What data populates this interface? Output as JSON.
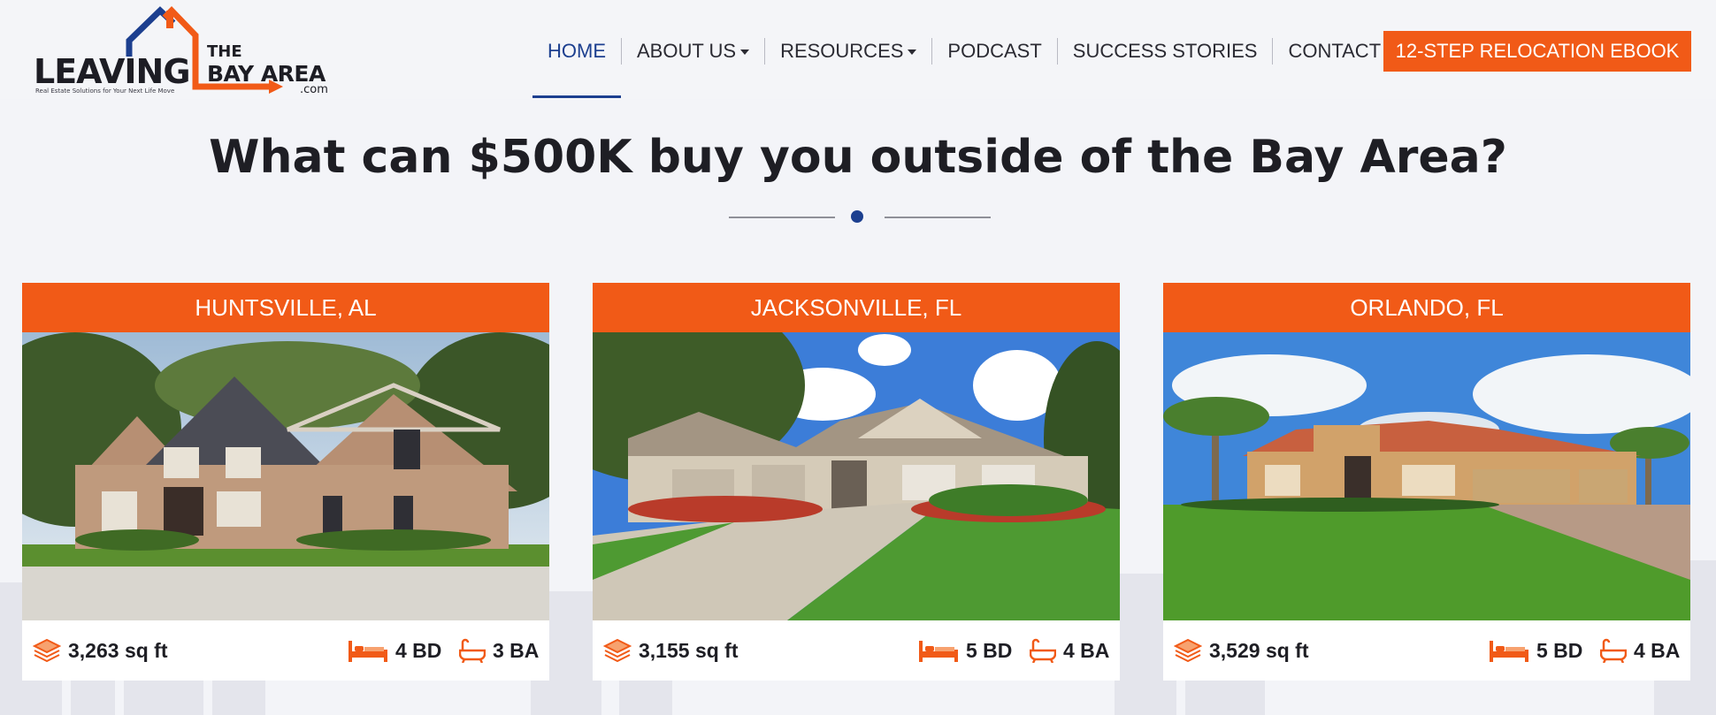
{
  "logo": {
    "leaving": "LEAVING",
    "the": "THE",
    "bay_area": "BAY AREA",
    "dotcom": ".com",
    "tagline": "Real Estate Solutions for Your Next Life Move"
  },
  "nav": {
    "items": [
      {
        "label": "HOME",
        "active": true
      },
      {
        "label": "ABOUT US",
        "dropdown": true
      },
      {
        "label": "RESOURCES",
        "dropdown": true
      },
      {
        "label": "PODCAST"
      },
      {
        "label": "SUCCESS STORIES"
      },
      {
        "label": "CONTACT"
      }
    ],
    "cta_label": "12-STEP RELOCATION EBOOK"
  },
  "headline": "What can $500K buy you outside of the Bay Area?",
  "cards": [
    {
      "city": "HUNTSVILLE, AL",
      "sqft": "3,263 sq ft",
      "beds": "4 BD",
      "baths": "3 BA"
    },
    {
      "city": "JACKSONVILLE, FL",
      "sqft": "3,155 sq ft",
      "beds": "5 BD",
      "baths": "4 BA"
    },
    {
      "city": "ORLANDO, FL",
      "sqft": "3,529 sq ft",
      "beds": "5 BD",
      "baths": "4 BA"
    }
  ],
  "colors": {
    "brand_orange": "#f15a17",
    "brand_navy": "#1c3f8f",
    "text_dark": "#1e1e24",
    "page_bg": "#f3f4f8"
  },
  "icons": {
    "area": "layers-icon",
    "beds": "bed-icon",
    "baths": "bathtub-icon"
  }
}
